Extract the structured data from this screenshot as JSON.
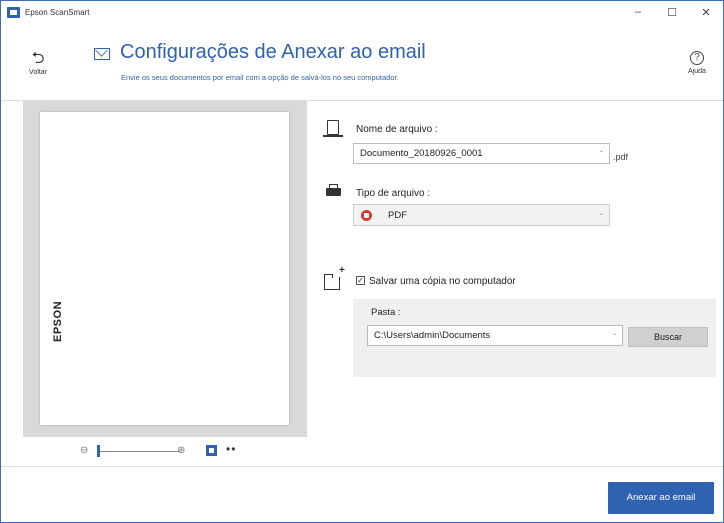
{
  "window": {
    "app_title": "Epson ScanSmart",
    "controls": {
      "minimize": "–",
      "maximize": "☐",
      "close": "✕"
    }
  },
  "header": {
    "back_label": "Voltar",
    "back_glyph": "⮌",
    "title": "Configurações de Anexar ao email",
    "subtitle": "Envie os seus documentos por email com a opção de salvá-los no seu computador.",
    "help_glyph": "?",
    "help_label": "Ajuda"
  },
  "preview": {
    "page_logo": "EPSON",
    "zoom": {
      "zoom_out_glyph": "⊖",
      "zoom_in_glyph": "⊕",
      "more_glyph": "••",
      "level": 0.0
    }
  },
  "form": {
    "filename_label": "Nome de arquivo :",
    "filename_value": "Documento_20180926_0001",
    "filename_ext": ".pdf",
    "filetype_label": "Tipo de arquivo :",
    "filetype_value": "PDF",
    "save_copy_label": "Salvar uma cópia no computador",
    "save_copy_checked": "✓",
    "folder_label": "Pasta :",
    "folder_value": "C:\\Users\\admin\\Documents",
    "browse_label": "Buscar",
    "chevron": "⌄"
  },
  "footer": {
    "attach_label": "Anexar ao email"
  },
  "colors": {
    "accent": "#2f62b0",
    "preview_bg": "#d9d9d9",
    "folder_box_bg": "#f0f0f0"
  },
  "icons": [
    "app-icon",
    "back-arrow-icon",
    "mail-icon",
    "help-icon",
    "document-icon",
    "printer-icon",
    "pdf-icon",
    "folder-add-icon",
    "zoom-out-icon",
    "zoom-in-icon",
    "fit-page-icon",
    "more-icon",
    "chevron-down-icon"
  ]
}
